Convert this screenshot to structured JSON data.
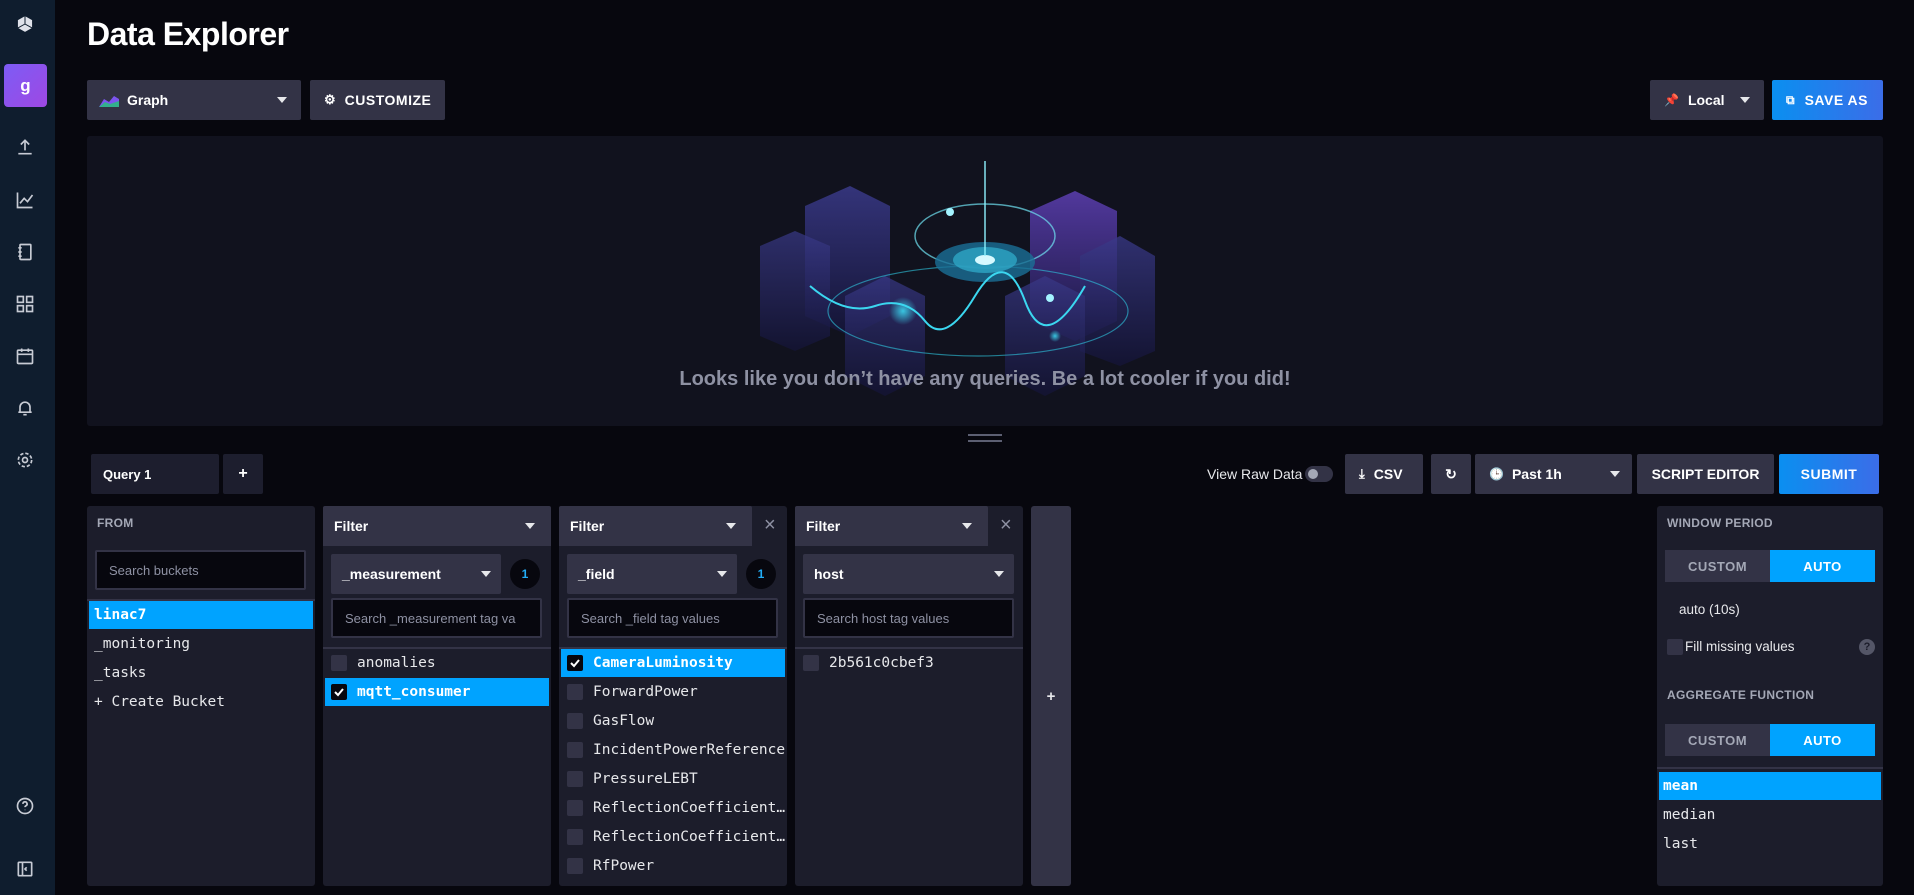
{
  "sidebar": {
    "org_initial": "g",
    "icons": [
      "logo-icon",
      "upload-icon",
      "graph-icon",
      "notebook-icon",
      "dashboard-icon",
      "tasks-calendar-icon",
      "alerts-bell-icon",
      "settings-gear-icon",
      "help-icon",
      "collapse-icon"
    ]
  },
  "header": {
    "title": "Data Explorer",
    "vis_type": "Graph",
    "customize_label": "CUSTOMIZE",
    "timezone_label": "Local",
    "save_as_label": "SAVE AS"
  },
  "graph": {
    "empty_message": "Looks like you don’t have any queries. Be a lot cooler if you did!"
  },
  "query_bar": {
    "query_tab": "Query 1",
    "add_tab": "+",
    "view_raw_label": "View Raw Data",
    "csv_label": "CSV",
    "time_range": "Past 1h",
    "script_editor_label": "SCRIPT EDITOR",
    "submit_label": "SUBMIT"
  },
  "from": {
    "label": "FROM",
    "search_placeholder": "Search buckets",
    "buckets": [
      "linac7",
      "_monitoring",
      "_tasks",
      "+ Create Bucket"
    ],
    "selected": "linac7"
  },
  "filters": [
    {
      "header": "Filter",
      "key": "_measurement",
      "count": "1",
      "search_placeholder": "Search _measurement tag va",
      "values": [
        {
          "label": "anomalies",
          "checked": false
        },
        {
          "label": "mqtt_consumer",
          "checked": true
        }
      ]
    },
    {
      "header": "Filter",
      "key": "_field",
      "count": "1",
      "search_placeholder": "Search _field tag values",
      "values": [
        {
          "label": "CameraLuminosity",
          "checked": true
        },
        {
          "label": "ForwardPower",
          "checked": false
        },
        {
          "label": "GasFlow",
          "checked": false
        },
        {
          "label": "IncidentPowerReference",
          "checked": false
        },
        {
          "label": "PressureLEBT",
          "checked": false
        },
        {
          "label": "ReflectionCoefficient…",
          "checked": false
        },
        {
          "label": "ReflectionCoefficient…",
          "checked": false
        },
        {
          "label": "RfPower",
          "checked": false
        }
      ]
    },
    {
      "header": "Filter",
      "key": "host",
      "count": "",
      "search_placeholder": "Search host tag values",
      "values": [
        {
          "label": "2b561c0cbef3",
          "checked": false
        }
      ]
    }
  ],
  "add_filter_label": "+",
  "window": {
    "window_period_label": "WINDOW PERIOD",
    "custom_label": "CUSTOM",
    "auto_label": "AUTO",
    "auto_value": "auto (10s)",
    "fill_missing_label": "Fill missing values",
    "aggregate_label": "AGGREGATE FUNCTION",
    "agg_custom_label": "CUSTOM",
    "agg_auto_label": "AUTO",
    "functions": [
      "mean",
      "median",
      "last"
    ],
    "selected_function": "mean"
  },
  "colors": {
    "accent": "#00a3ff",
    "sidebar": "#0f1d2e",
    "panel": "#1c1d2b"
  }
}
